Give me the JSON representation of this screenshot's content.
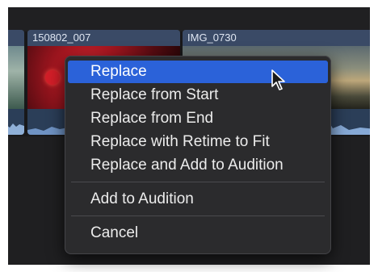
{
  "timeline": {
    "clips": [
      {
        "name": ""
      },
      {
        "name": "150802_007"
      },
      {
        "name": "IMG_0730"
      }
    ]
  },
  "context_menu": {
    "items": [
      {
        "label": "Replace",
        "highlighted": true
      },
      {
        "label": "Replace from Start"
      },
      {
        "label": "Replace from End"
      },
      {
        "label": "Replace with Retime to Fit"
      },
      {
        "label": "Replace and Add to Audition"
      }
    ],
    "audition_label": "Add to Audition",
    "cancel_label": "Cancel"
  },
  "colors": {
    "highlight": "#2b62d9",
    "menu_background": "#2b2b2d",
    "clip_header": "#3a4a66",
    "audio_lane": "#2b3e58"
  },
  "pointer": {
    "icon": "arrow-cursor-icon"
  }
}
